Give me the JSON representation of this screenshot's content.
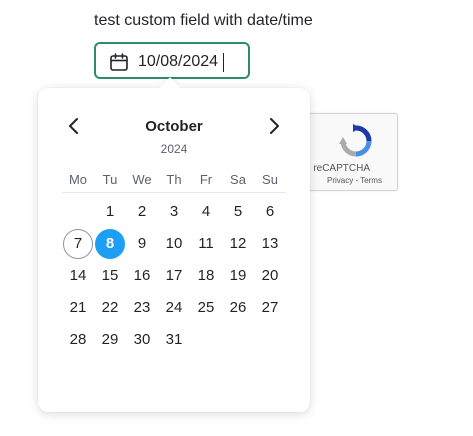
{
  "field": {
    "label": "test custom field with date/time",
    "value": "10/08/2024",
    "icon": "calendar-icon"
  },
  "calendar": {
    "month": "October",
    "year": "2024",
    "prev_icon": "chevron-left-icon",
    "next_icon": "chevron-right-icon",
    "weekdays": [
      "Mo",
      "Tu",
      "We",
      "Th",
      "Fr",
      "Sa",
      "Su"
    ],
    "first_weekday_offset": 1,
    "days": [
      "1",
      "2",
      "3",
      "4",
      "5",
      "6",
      "7",
      "8",
      "9",
      "10",
      "11",
      "12",
      "13",
      "14",
      "15",
      "16",
      "17",
      "18",
      "19",
      "20",
      "21",
      "22",
      "23",
      "24",
      "25",
      "26",
      "27",
      "28",
      "29",
      "30",
      "31"
    ],
    "today": "7",
    "selected": "8",
    "selected_color": "#1e9ef4"
  },
  "recaptcha": {
    "brand": "reCAPTCHA",
    "links": "Privacy - Terms",
    "logo": "recaptcha-logo"
  }
}
